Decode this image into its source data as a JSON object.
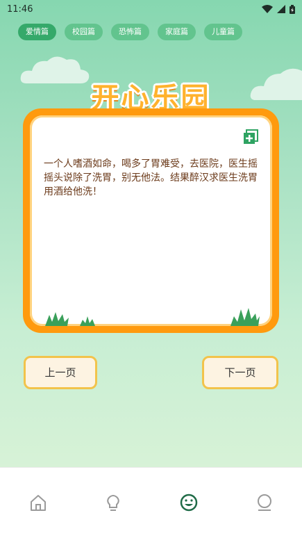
{
  "status": {
    "time": "11:46"
  },
  "tabs": [
    "爱情篇",
    "校园篇",
    "恐怖篇",
    "家庭篇",
    "儿童篇"
  ],
  "title": "开心乐园",
  "joke": "一个人嗜酒如命，喝多了胃难受，去医院，医生摇摇头说除了洗胃，别无他法。结果醉汉求医生洗胃用酒给他洗！",
  "buttons": {
    "prev": "上一页",
    "next": "下一页"
  },
  "icons": {
    "wifi": "wifi-icon",
    "signal": "signal-icon",
    "battery": "battery-icon",
    "copy": "copy-add-icon",
    "nav": [
      "home-icon",
      "lightbulb-icon",
      "smile-icon",
      "profile-icon"
    ]
  },
  "colors": {
    "accent": "#ff9a0e",
    "tab": "#62c48e",
    "active_nav": "#1f6b47"
  }
}
